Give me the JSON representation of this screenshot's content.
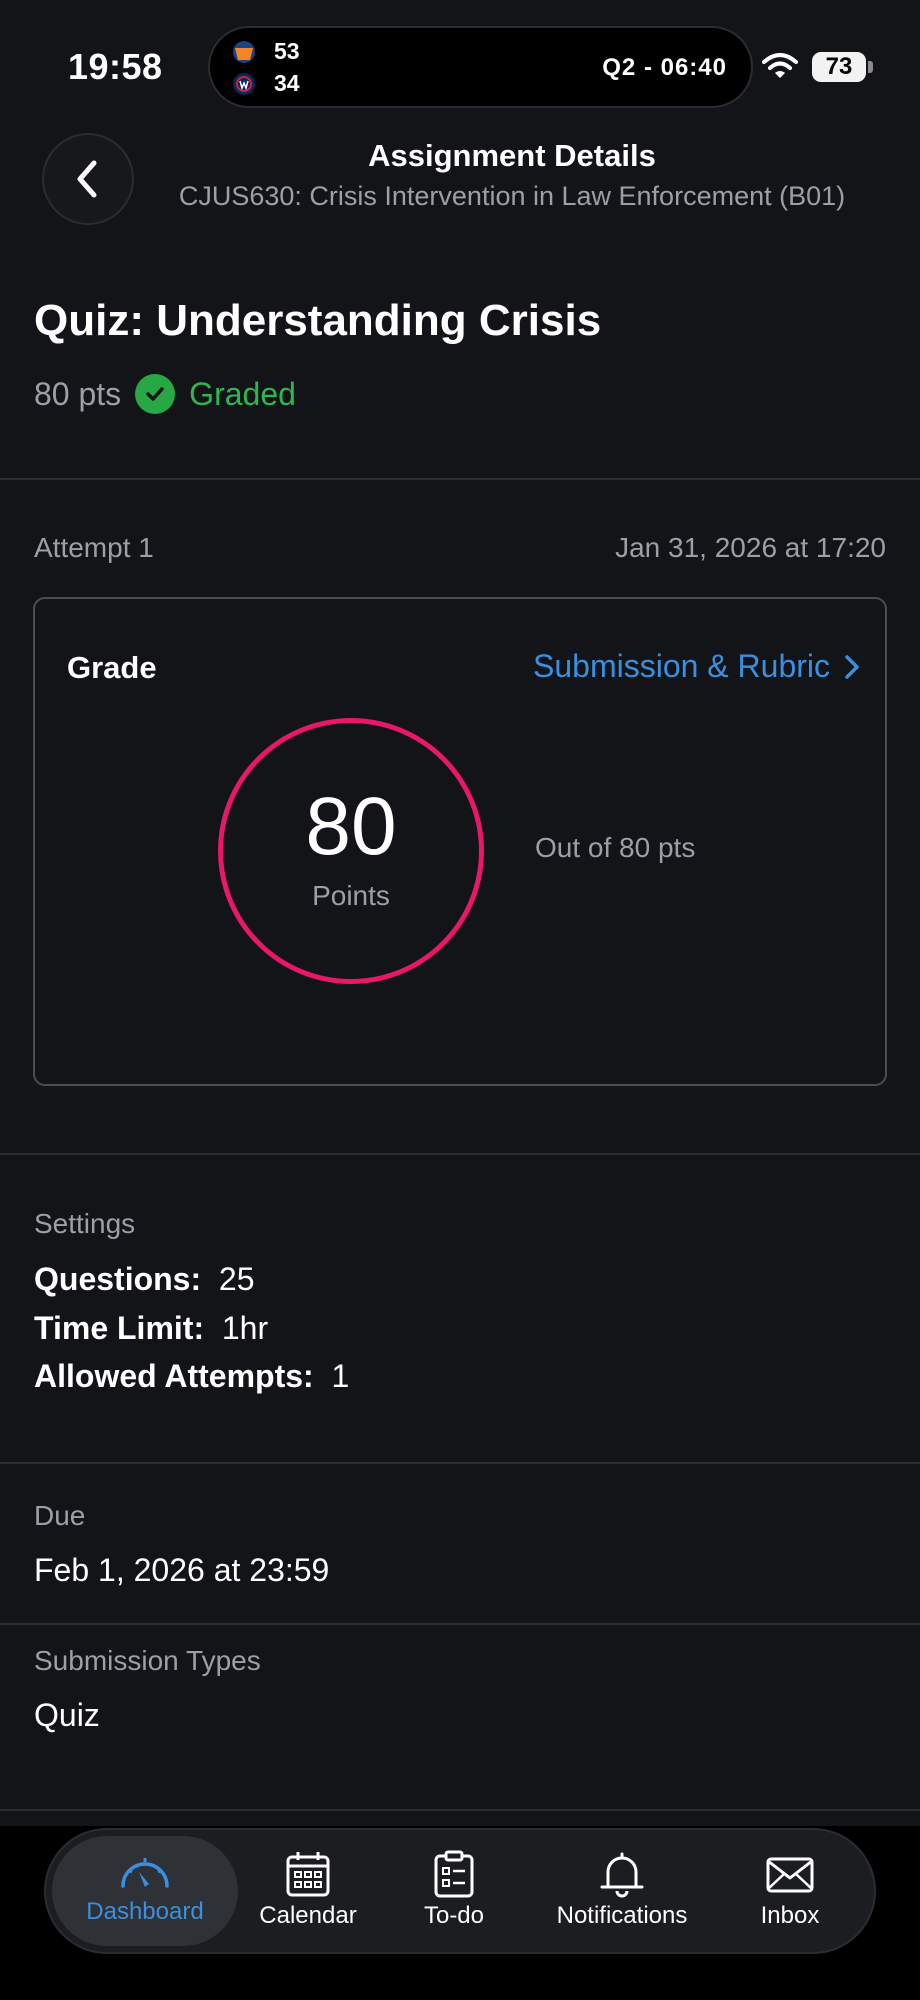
{
  "status_bar": {
    "time": "19:58",
    "live_activity": {
      "team1_score": "53",
      "team2_score": "34",
      "game_clock": "Q2 - 06:40"
    },
    "battery": "73"
  },
  "header": {
    "title": "Assignment Details",
    "subtitle": "CJUS630: Crisis Intervention in Law Enforcement (B01)"
  },
  "assignment": {
    "title": "Quiz: Understanding Crisis",
    "points": "80 pts",
    "status": "Graded"
  },
  "attempt": {
    "label": "Attempt 1",
    "date": "Jan 31, 2026 at 17:20"
  },
  "grade_card": {
    "label": "Grade",
    "link": "Submission & Rubric",
    "score": "80",
    "score_unit": "Points",
    "out_of": "Out of 80 pts",
    "score_fraction": 1.0
  },
  "settings": {
    "label": "Settings",
    "questions_label": "Questions:",
    "questions_value": "25",
    "time_limit_label": "Time Limit:",
    "time_limit_value": "1hr",
    "attempts_label": "Allowed Attempts:",
    "attempts_value": "1"
  },
  "due": {
    "label": "Due",
    "value": "Feb 1, 2026 at 23:59"
  },
  "submission_types": {
    "label": "Submission Types",
    "value": "Quiz"
  },
  "tabs": [
    {
      "label": "Dashboard",
      "icon": "dashboard-icon",
      "active": true
    },
    {
      "label": "Calendar",
      "icon": "calendar-icon",
      "active": false
    },
    {
      "label": "To-do",
      "icon": "clipboard-icon",
      "active": false
    },
    {
      "label": "Notifications",
      "icon": "bell-icon",
      "active": false
    },
    {
      "label": "Inbox",
      "icon": "envelope-icon",
      "active": false
    }
  ],
  "colors": {
    "background": "#121417",
    "accent_link": "#3b8fe0",
    "graded_green": "#2fb552",
    "grade_ring": "#e8176a"
  }
}
